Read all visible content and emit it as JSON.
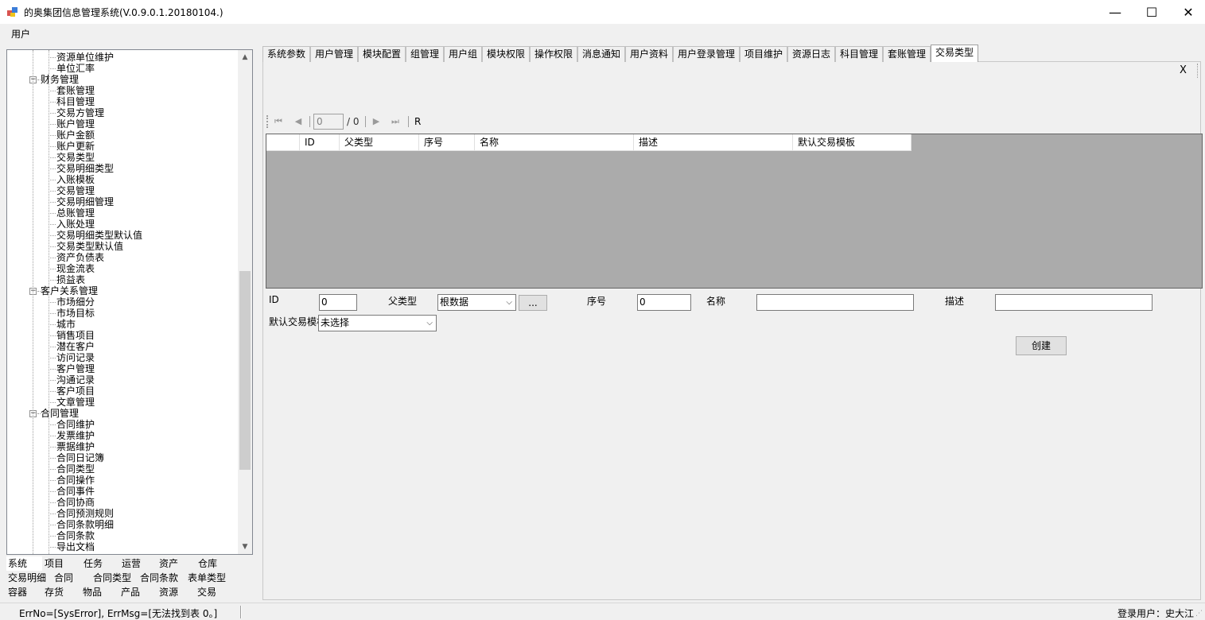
{
  "window": {
    "title": "的奥集团信息管理系统(V.0.9.0.1.20180104.)",
    "min_glyph": "—",
    "max_glyph": "☐",
    "close_glyph": "✕"
  },
  "menu": {
    "user": "用户"
  },
  "tree": {
    "items": [
      {
        "label": "资源单位维护",
        "level": 2
      },
      {
        "label": "单位汇率",
        "level": 2
      },
      {
        "label": "财务管理",
        "level": 1,
        "expander": "−"
      },
      {
        "label": "套账管理",
        "level": 2
      },
      {
        "label": "科目管理",
        "level": 2
      },
      {
        "label": "交易方管理",
        "level": 2
      },
      {
        "label": "账户管理",
        "level": 2
      },
      {
        "label": "账户金额",
        "level": 2
      },
      {
        "label": "账户更新",
        "level": 2
      },
      {
        "label": "交易类型",
        "level": 2
      },
      {
        "label": "交易明细类型",
        "level": 2
      },
      {
        "label": "入账模板",
        "level": 2
      },
      {
        "label": "交易管理",
        "level": 2
      },
      {
        "label": "交易明细管理",
        "level": 2
      },
      {
        "label": "总账管理",
        "level": 2
      },
      {
        "label": "入账处理",
        "level": 2
      },
      {
        "label": "交易明细类型默认值",
        "level": 2
      },
      {
        "label": "交易类型默认值",
        "level": 2
      },
      {
        "label": "资产负债表",
        "level": 2
      },
      {
        "label": "现金流表",
        "level": 2
      },
      {
        "label": "损益表",
        "level": 2
      },
      {
        "label": "客户关系管理",
        "level": 1,
        "expander": "−"
      },
      {
        "label": "市场细分",
        "level": 2
      },
      {
        "label": "市场目标",
        "level": 2
      },
      {
        "label": "城市",
        "level": 2
      },
      {
        "label": "销售项目",
        "level": 2
      },
      {
        "label": "潜在客户",
        "level": 2
      },
      {
        "label": "访问记录",
        "level": 2
      },
      {
        "label": "客户管理",
        "level": 2
      },
      {
        "label": "沟通记录",
        "level": 2
      },
      {
        "label": "客户项目",
        "level": 2
      },
      {
        "label": "文章管理",
        "level": 2
      },
      {
        "label": "合同管理",
        "level": 1,
        "expander": "−"
      },
      {
        "label": "合同维护",
        "level": 2
      },
      {
        "label": "发票维护",
        "level": 2
      },
      {
        "label": "票据维护",
        "level": 2
      },
      {
        "label": "合同日记簿",
        "level": 2
      },
      {
        "label": "合同类型",
        "level": 2
      },
      {
        "label": "合同操作",
        "level": 2
      },
      {
        "label": "合同事件",
        "level": 2
      },
      {
        "label": "合同协商",
        "level": 2
      },
      {
        "label": "合同预测规则",
        "level": 2
      },
      {
        "label": "合同条款明细",
        "level": 2
      },
      {
        "label": "合同条款",
        "level": 2
      },
      {
        "label": "导出文档",
        "level": 2
      }
    ],
    "scroll_up_glyph": "▲",
    "scroll_down_glyph": "▼"
  },
  "nav_tabs": {
    "row1": [
      "系统",
      "项目",
      "任务",
      "运营",
      "资产",
      "仓库"
    ],
    "row2": [
      "交易明细",
      "合同",
      "合同类型",
      "合同条款",
      "表单类型"
    ],
    "row3": [
      "容器",
      "存货",
      "物品",
      "产品",
      "资源",
      "交易"
    ]
  },
  "tabs": [
    "系统参数",
    "用户管理",
    "模块配置",
    "组管理",
    "用户组",
    "模块权限",
    "操作权限",
    "消息通知",
    "用户资料",
    "用户登录管理",
    "项目维护",
    "资源日志",
    "科目管理",
    "套账管理",
    "交易类型"
  ],
  "active_tab": "交易类型",
  "close_label": "X",
  "navigator": {
    "first": "⏮",
    "prev": "◀",
    "position": "0",
    "total": "/ 0",
    "next": "▶",
    "last": "⏭",
    "refresh": "R"
  },
  "grid": {
    "columns": [
      "",
      "ID",
      "父类型",
      "序号",
      "名称",
      "描述",
      "默认交易模板"
    ],
    "rows": []
  },
  "form": {
    "id_label": "ID",
    "id_value": "0",
    "parent_label": "父类型",
    "parent_value": "根数据",
    "browse_label": "...",
    "order_label": "序号",
    "order_value": "0",
    "name_label": "名称",
    "name_value": "",
    "desc_label": "描述",
    "desc_value": "",
    "template_label": "默认交易模板",
    "template_value": "未选择",
    "create_label": "创建"
  },
  "status": {
    "message": "ErrNo=[SysError], ErrMsg=[无法找到表 0。]",
    "user": "登录用户：史大江"
  }
}
